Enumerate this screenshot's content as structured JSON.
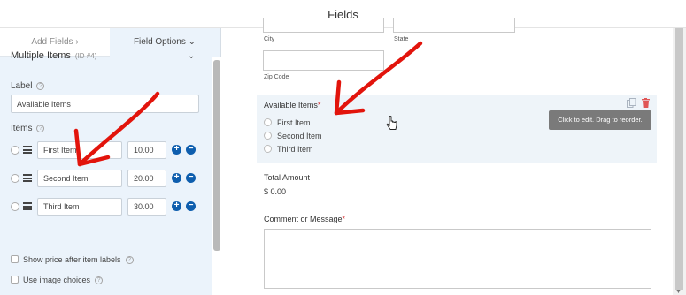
{
  "window": {
    "title": "Fields"
  },
  "panel": {
    "tabs": {
      "add": "Add Fields ›",
      "options": "Field Options ⌄"
    },
    "field": {
      "name": "Multiple Items",
      "id": "(ID #4)"
    },
    "label_heading": "Label",
    "label_value": "Available Items",
    "items_heading": "Items",
    "items": [
      {
        "label": "First Item",
        "price": "10.00"
      },
      {
        "label": "Second Item",
        "price": "20.00"
      },
      {
        "label": "Third Item",
        "price": "30.00"
      }
    ],
    "checkboxes": {
      "show_price": "Show price after item labels",
      "image_choices": "Use image choices"
    }
  },
  "form": {
    "city_label": "City",
    "state_label": "State",
    "zip_label": "Zip Code",
    "available": {
      "label": "Available Items",
      "required_mark": "*",
      "options": [
        "First Item",
        "Second Item",
        "Third Item"
      ]
    },
    "tooltip": "Click to edit. Drag to reorder.",
    "total": {
      "label": "Total Amount",
      "value": "$ 0.00"
    },
    "comment": {
      "label": "Comment or Message",
      "required_mark": "*"
    }
  },
  "colors": {
    "accent": "#0e5eae",
    "required": "#d63638",
    "annotation_arrow": "#e2140c",
    "panel_bg": "#ebf3fb"
  },
  "icons": [
    "chevron-down-icon",
    "help-icon",
    "drag-handle-icon",
    "plus-icon",
    "minus-icon",
    "duplicate-icon",
    "trash-icon",
    "cursor-icon",
    "annotation-arrow"
  ]
}
